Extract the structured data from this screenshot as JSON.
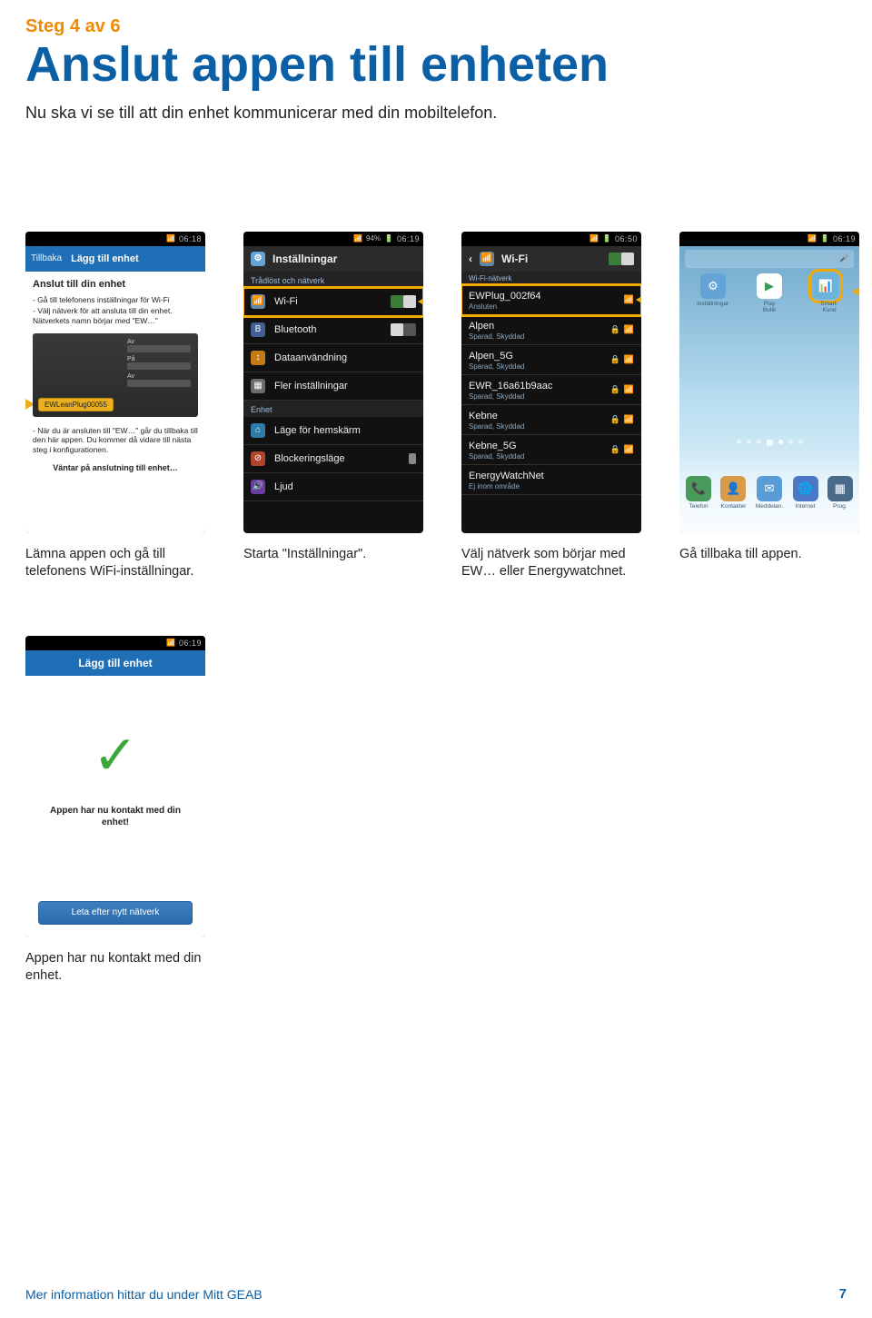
{
  "step_label": "Steg 4 av 6",
  "title": "Anslut appen till enheten",
  "intro": "Nu ska vi se till att din enhet kommunicerar med din mobiltelefon.",
  "captions": {
    "c1": "Lämna appen och gå till telefonens WiFi-inställningar.",
    "c2": "Starta \"Inställningar\".",
    "c3": "Välj nätverk som börjar med EW… eller Energywatchnet.",
    "c4": "Gå tillbaka till appen.",
    "c5": "Appen har nu kontakt med din enhet."
  },
  "s1": {
    "back": "Tillbaka",
    "title": "Lägg till enhet",
    "heading": "Anslut till din enhet",
    "li1": "- Gå till telefonens inställningar för Wi-Fi",
    "li2": "- Välj nätverk för att ansluta till din enhet. Nätverkets namn börjar med \"EW…\"",
    "card_pill": "EWLeanPlug00055",
    "li3": "- När du är ansluten till \"EW…\" går du tillbaka till den här appen. Du kommer då vidare till nästa steg i konfigurationen.",
    "wait": "Väntar på anslutning till enhet…"
  },
  "s2": {
    "clock": "06:19",
    "batt": "94%",
    "title": "Inställningar",
    "section": "Trådlöst och nätverk",
    "wifi": "Wi-Fi",
    "bt": "Bluetooth",
    "data": "Dataanvändning",
    "more": "Fler inställningar",
    "section2": "Enhet",
    "home": "Läge för hemskärm",
    "block": "Blockeringsläge",
    "sound": "Ljud"
  },
  "s3": {
    "clock": "06:50",
    "title": "Wi-Fi",
    "subhead": "Wi-Fi-nätverk",
    "hl_name": "EWPlug_002f64",
    "hl_sub": "Ansluten",
    "nets": [
      {
        "name": "Alpen",
        "sub": "Sparad, Skyddad"
      },
      {
        "name": "Alpen_5G",
        "sub": "Sparad, Skyddad"
      },
      {
        "name": "EWR_16a61b9aac",
        "sub": "Sparad, Skyddad"
      },
      {
        "name": "Kebne",
        "sub": "Sparad, Skyddad"
      },
      {
        "name": "Kebne_5G",
        "sub": "Sparad, Skyddad"
      },
      {
        "name": "EnergyWatchNet",
        "sub": "Ej inom område"
      }
    ]
  },
  "s4": {
    "clock": "06:19",
    "apps": [
      "Inställningar",
      "Play Butik",
      "Smart-Kund"
    ],
    "dock": [
      "Telefon",
      "Kontakter",
      "Meddelan.",
      "Internet",
      "Prog."
    ]
  },
  "s5": {
    "title": "Lägg till enhet",
    "msg": "Appen har nu kontakt med din enhet!",
    "btn": "Leta efter nytt nätverk"
  },
  "footer": "Mer information hittar du under Mitt GEAB",
  "page_num": "7"
}
